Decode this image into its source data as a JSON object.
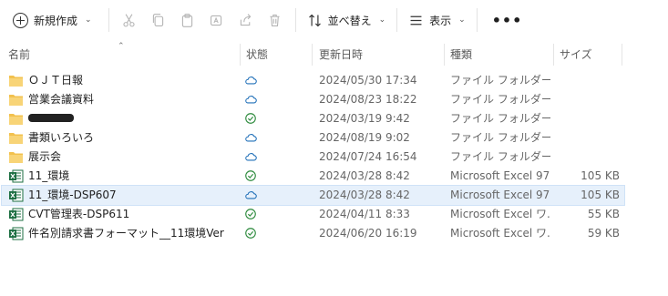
{
  "toolbar": {
    "new_label": "新規作成",
    "sort_label": "並べ替え",
    "view_label": "表示",
    "more_label": "•••"
  },
  "columns": {
    "name": "名前",
    "status": "状態",
    "date": "更新日時",
    "type": "種類",
    "size": "サイズ"
  },
  "files": [
    {
      "name": "ＯＪＴ日報",
      "kind": "folder",
      "status": "cloud",
      "date": "2024/05/30 17:34",
      "type": "ファイル フォルダー",
      "size": ""
    },
    {
      "name": "営業会議資料",
      "kind": "folder",
      "status": "cloud",
      "date": "2024/08/23 18:22",
      "type": "ファイル フォルダー",
      "size": ""
    },
    {
      "name": "",
      "kind": "folder",
      "status": "synced",
      "date": "2024/03/19 9:42",
      "type": "ファイル フォルダー",
      "size": "",
      "redacted": true
    },
    {
      "name": "書類いろいろ",
      "kind": "folder",
      "status": "cloud",
      "date": "2024/08/19 9:02",
      "type": "ファイル フォルダー",
      "size": ""
    },
    {
      "name": "展示会",
      "kind": "folder",
      "status": "cloud",
      "date": "2024/07/24 16:54",
      "type": "ファイル フォルダー",
      "size": ""
    },
    {
      "name": "11_環境",
      "kind": "excel",
      "status": "synced",
      "date": "2024/03/28 8:42",
      "type": "Microsoft Excel 97...",
      "size": "105 KB"
    },
    {
      "name": "11_環境-DSP607",
      "kind": "excel",
      "status": "cloud",
      "date": "2024/03/28 8:42",
      "type": "Microsoft Excel 97...",
      "size": "105 KB",
      "selected": true
    },
    {
      "name": "CVT管理表-DSP611",
      "kind": "excel",
      "status": "synced",
      "date": "2024/04/11 8:33",
      "type": "Microsoft Excel ワ...",
      "size": "55 KB"
    },
    {
      "name": "件名別請求書フォーマット__11環境Ver",
      "kind": "excel",
      "status": "synced",
      "date": "2024/06/20 16:19",
      "type": "Microsoft Excel ワ...",
      "size": "59 KB"
    }
  ],
  "colors": {
    "accent": "#0a64b8",
    "folder": "#f2c14e",
    "excel": "#1d6f42",
    "synced": "#2e8b3e",
    "cloud": "#1f6fb8"
  }
}
